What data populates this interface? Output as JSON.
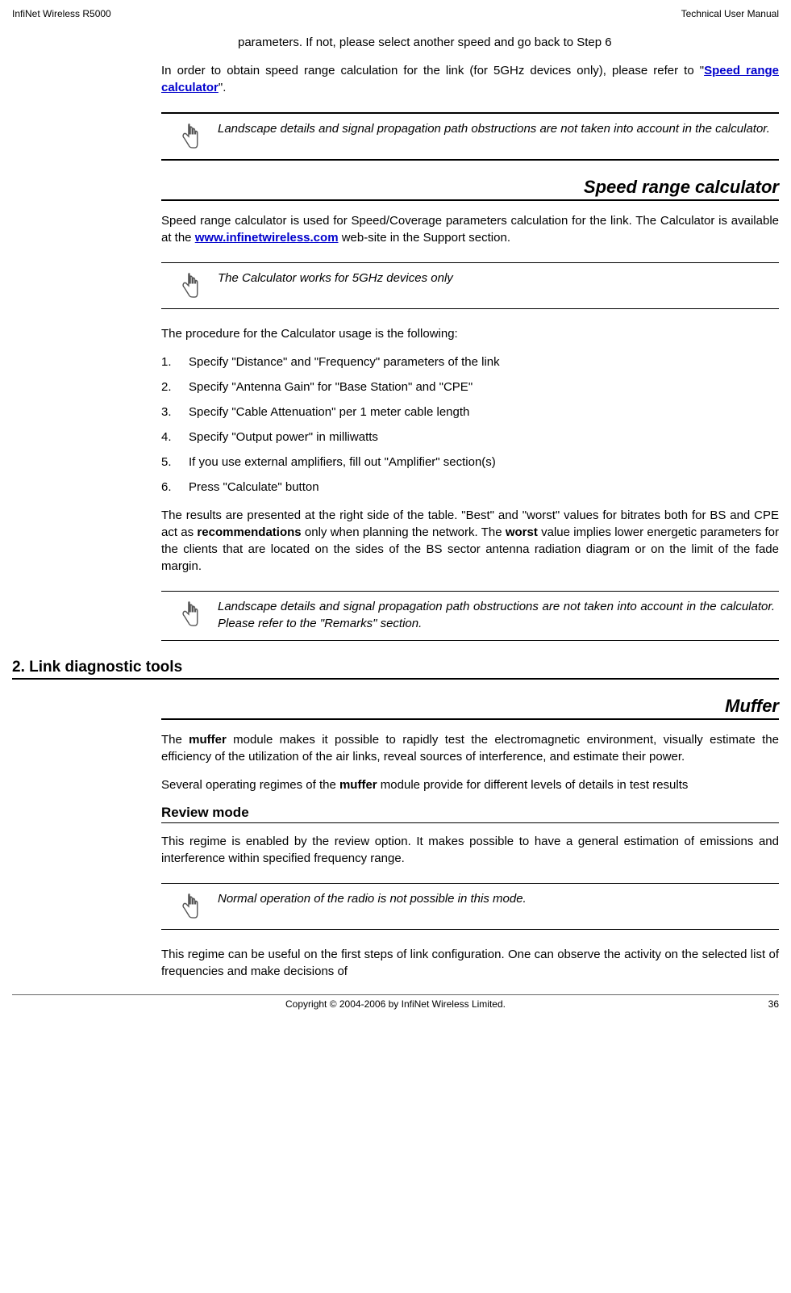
{
  "header": {
    "left": "InfiNet Wireless R5000",
    "right": "Technical User Manual"
  },
  "intro": {
    "paramText": "parameters. If not, please select another speed and go back to Step 6",
    "speedRangeText1": "In order to obtain speed range calculation for the link (for 5GHz devices only), please refer to \"",
    "speedRangeLink": "Speed range calculator",
    "speedRangeText2": "\"."
  },
  "note1": "Landscape details and signal propagation path obstructions are not taken into account in the calculator.",
  "sectionSpeed": {
    "heading": "Speed range calculator",
    "para1a": "Speed range calculator is used for Speed/Coverage parameters calculation for the link. The Calculator is available at the ",
    "para1link": "www.infinetwireless.com",
    "para1b": " web-site in the Support section.",
    "note": "The Calculator works for 5GHz devices only",
    "procIntro": "The procedure for the Calculator usage is the following:",
    "steps": [
      "Specify \"Distance\" and \"Frequency\" parameters of the link",
      "Specify \"Antenna Gain\" for \"Base Station\" and \"CPE\"",
      "Specify \"Cable Attenuation\" per 1 meter cable length",
      "Specify \"Output power\" in milliwatts",
      "If you use external amplifiers, fill out \"Amplifier\" section(s)",
      "Press \"Calculate\" button"
    ],
    "resultsPara1": "The results are presented at the right side of the table. \"Best\" and \"worst\" values for bitrates both for BS and CPE act as ",
    "resultsBold1": "recommendations",
    "resultsPara2": " only when planning the network. The ",
    "resultsBold2": "worst",
    "resultsPara3": " value implies lower energetic parameters for the clients that are located on the sides of the BS sector antenna radiation diagram or on the limit of the fade margin.",
    "note2": "Landscape details and signal propagation path obstructions are not taken into account in the calculator. Please refer to the \"Remarks\" section."
  },
  "section2": {
    "heading": "2. Link diagnostic tools"
  },
  "muffer": {
    "heading": "Muffer",
    "para1a": "The ",
    "bold1": "muffer",
    "para1b": " module makes it possible to rapidly test the electromagnetic environment, visually estimate the efficiency of the utilization of the air links, reveal sources of interference, and estimate their power.",
    "para2a": "Several operating regimes of the ",
    "bold2": "muffer",
    "para2b": " module provide for different levels of details in test results",
    "subheading": "Review mode",
    "para3": "This regime is enabled by the review option. It makes possible to have a general estimation of emissions and interference within specified frequency range.",
    "note": "Normal operation of the radio is not possible in this mode.",
    "para4": "This regime can be useful on the first steps of link configuration. One can observe the activity on the selected list of frequencies and make decisions of"
  },
  "footer": {
    "copyright": "Copyright © 2004-2006 by InfiNet Wireless Limited.",
    "page": "36"
  }
}
